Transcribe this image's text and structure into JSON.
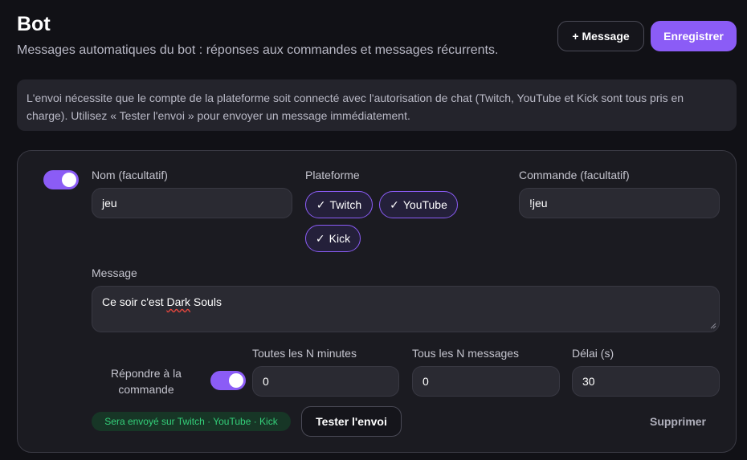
{
  "header": {
    "title": "Bot",
    "subtitle": "Messages automatiques du bot : réponses aux commandes et messages récurrents.",
    "add_message_label": "Message",
    "save_label": "Enregistrer"
  },
  "notice": {
    "text": "L'envoi nécessite que le compte de la plateforme soit connecté avec l'autorisation de chat (Twitch, YouTube et Kick sont tous pris en charge). Utilisez « Tester l'envoi » pour envoyer un message immédiatement."
  },
  "card": {
    "enabled": true,
    "name_label": "Nom (facultatif)",
    "name_value": "jeu",
    "platform_label": "Plateforme",
    "platforms": [
      {
        "label": "Twitch",
        "selected": true
      },
      {
        "label": "YouTube",
        "selected": true
      },
      {
        "label": "Kick",
        "selected": true
      }
    ],
    "command_label": "Commande (facultatif)",
    "command_value": "!jeu",
    "message_label": "Message",
    "message_before": "Ce soir c'est ",
    "message_spell": "Dark",
    "message_after": " Souls",
    "respond_label": "Répondre à la commande",
    "respond_enabled": true,
    "interval_minutes_label": "Toutes les N minutes",
    "interval_minutes_value": "0",
    "interval_messages_label": "Tous les N messages",
    "interval_messages_value": "0",
    "delay_label": "Délai (s)",
    "delay_value": "30",
    "badge_text": "Sera envoyé sur Twitch · YouTube · Kick",
    "test_label": "Tester l'envoi",
    "delete_label": "Supprimer"
  },
  "colors": {
    "accent": "#8b5cf6",
    "background": "#111116",
    "badge_text": "#34d07a"
  }
}
